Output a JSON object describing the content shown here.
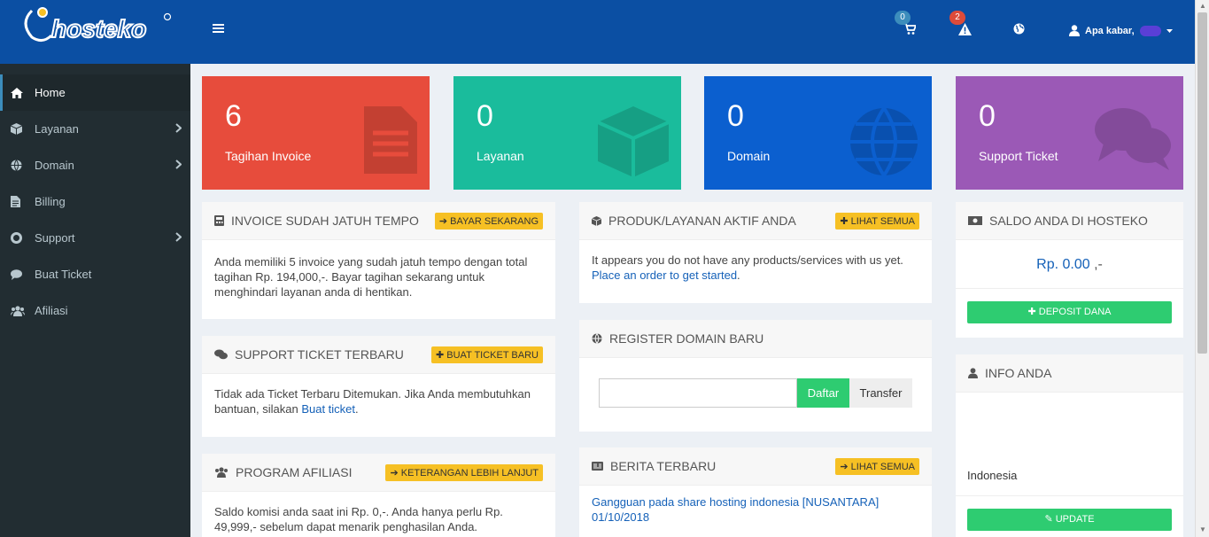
{
  "header": {
    "brand": "hosteko",
    "cart_badge": "0",
    "alert_badge": "2",
    "greeting": "Apa kabar,"
  },
  "sidebar": {
    "items": [
      {
        "label": "Home"
      },
      {
        "label": "Layanan"
      },
      {
        "label": "Domain"
      },
      {
        "label": "Billing"
      },
      {
        "label": "Support"
      },
      {
        "label": "Buat Ticket"
      },
      {
        "label": "Afiliasi"
      }
    ]
  },
  "stats": [
    {
      "value": "6",
      "label": "Tagihan Invoice",
      "color": "#e74c3c"
    },
    {
      "value": "0",
      "label": "Layanan",
      "color": "#1abc9c"
    },
    {
      "value": "0",
      "label": "Domain",
      "color": "#0b5fcf"
    },
    {
      "value": "0",
      "label": "Support Ticket",
      "color": "#9b59b6"
    }
  ],
  "invoice_panel": {
    "title": "Invoice Sudah Jatuh Tempo",
    "button": "Bayar Sekarang",
    "body": "Anda memiliki 5 invoice yang sudah jatuh tempo dengan total tagihan Rp. 194,000,-. Bayar tagihan sekarang untuk menghindari layanan anda di hentikan."
  },
  "support_panel": {
    "title": "Support Ticket Terbaru",
    "button": "Buat Ticket Baru",
    "body": "Tidak ada Ticket Terbaru Ditemukan. Jika Anda membutuhkan bantuan, silakan",
    "link": "Buat ticket",
    "suffix": "."
  },
  "affiliate_panel": {
    "title": "Program Afiliasi",
    "button": "Keterangan Lebih Lanjut",
    "body": "Saldo komisi anda saat ini Rp. 0,-. Anda hanya perlu Rp. 49,999,- sebelum dapat menarik penghasilan Anda."
  },
  "products_panel": {
    "title": "Produk/Layanan Aktif Anda",
    "button": "Lihat Semua",
    "body": "It appears you do not have any products/services with us yet.",
    "link": "Place an order to get started",
    "suffix": "."
  },
  "domain_panel": {
    "title": "Register Domain Baru",
    "input_value": "",
    "register_button": "Daftar",
    "transfer_button": "Transfer"
  },
  "news_panel": {
    "title": "Berita Terbaru",
    "button": "Lihat Semua",
    "item_title": "Gangguan pada share hosting indonesia [NUSANTARA]",
    "item_date": "01/10/2018"
  },
  "balance_panel": {
    "title": "Saldo Anda di Hosteko",
    "amount": "Rp. 0.00",
    "amount_suffix": ",-",
    "button": "Deposit Dana"
  },
  "info_panel": {
    "title": "Info Anda",
    "country": "Indonesia",
    "button": "Update"
  }
}
